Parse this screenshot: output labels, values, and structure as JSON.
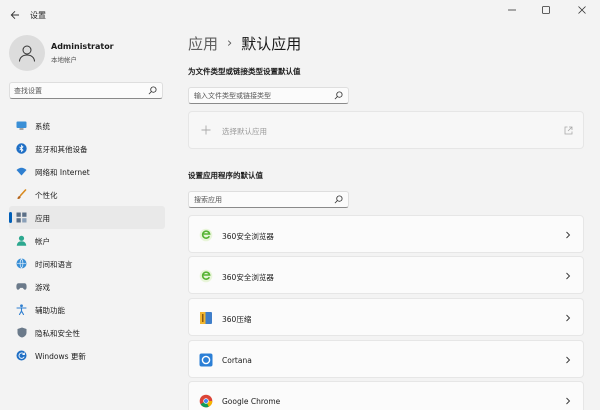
{
  "window": {
    "title": "设置"
  },
  "user": {
    "name": "Administrator",
    "account_type": "本地帐户"
  },
  "sidebar": {
    "search_placeholder": "查找设置",
    "items": [
      {
        "label": "系统",
        "icon": "monitor-icon",
        "active": false
      },
      {
        "label": "蓝牙和其他设备",
        "icon": "bluetooth-icon",
        "active": false
      },
      {
        "label": "网络和 Internet",
        "icon": "wifi-icon",
        "active": false
      },
      {
        "label": "个性化",
        "icon": "brush-icon",
        "active": false
      },
      {
        "label": "应用",
        "icon": "apps-icon",
        "active": true
      },
      {
        "label": "帐户",
        "icon": "person-icon",
        "active": false
      },
      {
        "label": "时间和语言",
        "icon": "globe-clock-icon",
        "active": false
      },
      {
        "label": "游戏",
        "icon": "gamepad-icon",
        "active": false
      },
      {
        "label": "辅助功能",
        "icon": "accessibility-icon",
        "active": false
      },
      {
        "label": "隐私和安全性",
        "icon": "shield-icon",
        "active": false
      },
      {
        "label": "Windows 更新",
        "icon": "update-icon",
        "active": false
      }
    ]
  },
  "breadcrumb": {
    "parent": "应用",
    "separator": "›",
    "current": "默认应用"
  },
  "filetype_section": {
    "title": "为文件类型或链接类型设置默认值",
    "input_placeholder": "输入文件类型或链接类型",
    "choose_default_label": "选择默认应用"
  },
  "apps_section": {
    "title": "设置应用程序的默认值",
    "search_placeholder": "搜索应用",
    "apps": [
      {
        "name": "360安全浏览器",
        "icon": "360-browser-icon"
      },
      {
        "name": "360安全浏览器",
        "icon": "360-browser-icon"
      },
      {
        "name": "360压缩",
        "icon": "360-zip-icon"
      },
      {
        "name": "Cortana",
        "icon": "cortana-icon"
      },
      {
        "name": "Google Chrome",
        "icon": "chrome-icon"
      }
    ]
  },
  "colors": {
    "accent": "#005fb8",
    "background": "#f3f3f3",
    "card": "#fbfbfb"
  }
}
